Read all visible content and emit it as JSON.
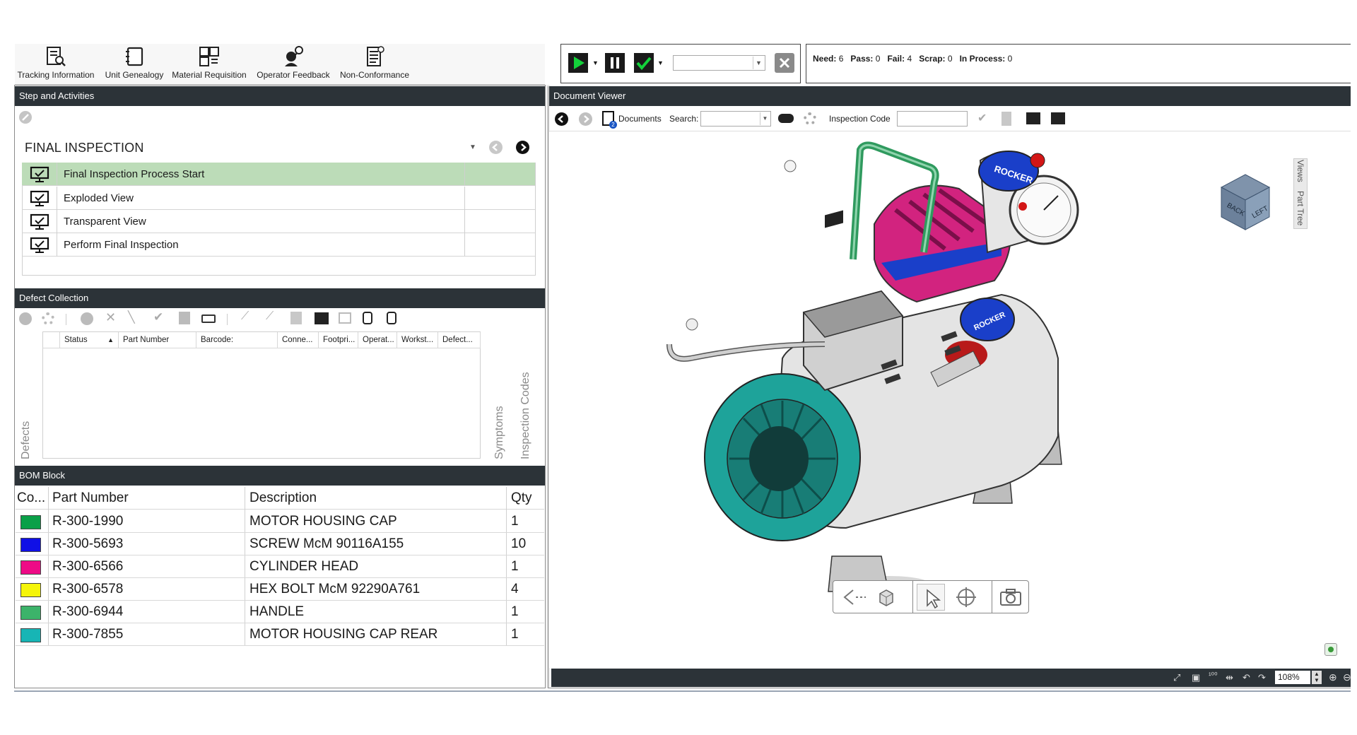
{
  "toolbar": {
    "items": [
      {
        "label": "Tracking Information",
        "icon": "tracking-information-icon"
      },
      {
        "label": "Unit Genealogy",
        "icon": "unit-genealogy-icon"
      },
      {
        "label": "Material Requisition",
        "icon": "material-requisition-icon"
      },
      {
        "label": "Operator Feedback",
        "icon": "operator-feedback-icon"
      },
      {
        "label": "Non-Conformance",
        "icon": "non-conformance-icon"
      }
    ]
  },
  "controls": {
    "play_icon": "play-icon",
    "pause_icon": "pause-icon",
    "check_icon": "check-icon",
    "combo_value": "",
    "clear_icon": "clear-icon"
  },
  "counts": {
    "need_label": "Need:",
    "need": "6",
    "pass_label": "Pass:",
    "pass": "0",
    "fail_label": "Fail:",
    "fail": "4",
    "scrap_label": "Scrap:",
    "scrap": "0",
    "inprocess_label": "In Process:",
    "inprocess": "0"
  },
  "steps": {
    "header": "Step and Activities",
    "title": "FINAL INSPECTION",
    "items": [
      {
        "label": "Final Inspection Process Start",
        "selected": true
      },
      {
        "label": "Exploded View",
        "selected": false
      },
      {
        "label": "Transparent View",
        "selected": false
      },
      {
        "label": "Perform Final Inspection",
        "selected": false
      }
    ]
  },
  "defects": {
    "header": "Defect Collection",
    "columns": [
      "Status",
      "Part Number",
      "Barcode:",
      "Conne...",
      "Footpri...",
      "Operat...",
      "Workst...",
      "Defect..."
    ],
    "side_left": "Defects",
    "side_right_1": "Symptoms",
    "side_right_2": "Inspection Codes"
  },
  "bom": {
    "header": "BOM Block",
    "columns": [
      "Co...",
      "Part Number",
      "Description",
      "Qty"
    ],
    "rows": [
      {
        "color": "#0aa048",
        "part": "R-300-1990",
        "desc": "MOTOR HOUSING CAP",
        "qty": "1"
      },
      {
        "color": "#1010e6",
        "part": "R-300-5693",
        "desc": "SCREW McM 90116A155",
        "qty": "10"
      },
      {
        "color": "#ee0a86",
        "part": "R-300-6566",
        "desc": "CYLINDER HEAD",
        "qty": "1"
      },
      {
        "color": "#f5f50a",
        "part": "R-300-6578",
        "desc": "HEX BOLT McM 92290A761",
        "qty": "4"
      },
      {
        "color": "#3cb36a",
        "part": "R-300-6944",
        "desc": "HANDLE",
        "qty": "1"
      },
      {
        "color": "#17b5b5",
        "part": "R-300-7855",
        "desc": "MOTOR HOUSING CAP REAR",
        "qty": "1"
      }
    ]
  },
  "viewer": {
    "header": "Document Viewer",
    "documents_label": "Documents",
    "search_label": "Search:",
    "search_value": "",
    "inspection_code_label": "Inspection Code",
    "inspection_code_value": "",
    "views_tab": "Views",
    "parttree_tab": "Part Tree",
    "cube_face_back": "BACK",
    "cube_face_left": "LEFT",
    "zoom": "108%",
    "brand_text": "ROCKER"
  },
  "colors": {
    "header_bg": "#2c3338",
    "selected_row": "#bcdcb8",
    "handle": "#2f9a5e",
    "cylinder_head": "#d2237f",
    "motor_cap": "#1ea39a"
  }
}
